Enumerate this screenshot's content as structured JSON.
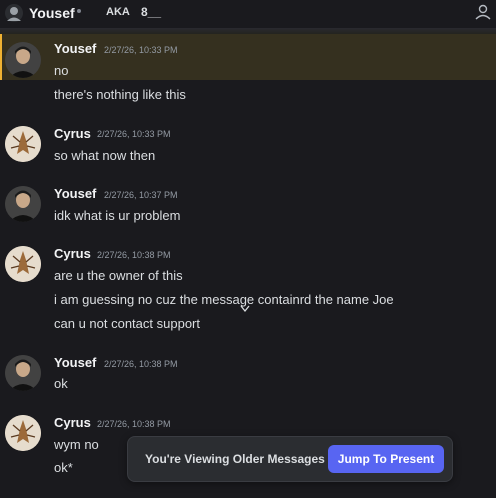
{
  "header": {
    "channel_name": "Yousef",
    "aka_label": "AKA",
    "nickname": "8__",
    "colors": {
      "accent": "#f0b232",
      "brand": "#5865f2"
    }
  },
  "messages": [
    {
      "author": "Yousef",
      "timestamp": "2/27/26, 10:33 PM",
      "lines": [
        "no",
        "there's nothing like this"
      ],
      "highlighted": true
    },
    {
      "author": "Cyrus",
      "timestamp": "2/27/26, 10:33 PM",
      "lines": [
        "so what now then"
      ]
    },
    {
      "author": "Yousef",
      "timestamp": "2/27/26, 10:37 PM",
      "lines": [
        "idk what is ur problem"
      ]
    },
    {
      "author": "Cyrus",
      "timestamp": "2/27/26, 10:38 PM",
      "lines": [
        "are u the owner of this",
        "i am guessing no cuz the message containrd the name Joe",
        "can u not contact support"
      ]
    },
    {
      "author": "Yousef",
      "timestamp": "2/27/26, 10:38 PM",
      "lines": [
        "ok"
      ]
    },
    {
      "author": "Cyrus",
      "timestamp": "2/27/26, 10:38 PM",
      "lines": [
        "wym no",
        "ok*"
      ]
    }
  ],
  "banner": {
    "text": "You're Viewing Older Messages",
    "button": "Jump To Present"
  }
}
